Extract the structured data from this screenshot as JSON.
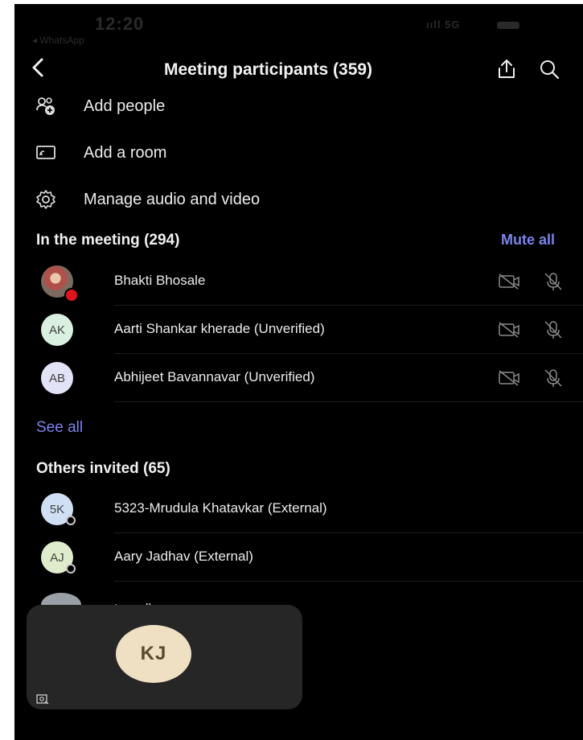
{
  "status": {
    "time": "12:20",
    "back_app": "◂ WhatsApp",
    "signal": "5G",
    "signal_bars": "ııll"
  },
  "header": {
    "title": "Meeting participants (359)"
  },
  "actions": [
    {
      "label": "Add people",
      "icon": "add-people-icon"
    },
    {
      "label": "Add a room",
      "icon": "room-icon"
    },
    {
      "label": "Manage audio and video",
      "icon": "gear-icon"
    }
  ],
  "in_meeting": {
    "heading": "In the meeting (294)",
    "mute_all": "Mute all",
    "participants": [
      {
        "name": "Bhakti Bhosale",
        "initials": "",
        "avatar": "photo",
        "avatar_color": "#b0504a"
      },
      {
        "name": "Aarti Shankar kherade (Unverified)",
        "initials": "AK",
        "avatar_color": "#d9efe0"
      },
      {
        "name": "Abhijeet Bavannavar  (Unverified)",
        "initials": "AB",
        "avatar_color": "#e2e3f7"
      }
    ],
    "see_all": "See all"
  },
  "others_invited": {
    "heading": "Others invited (65)",
    "people": [
      {
        "name": "5323-Mrudula Khatavkar (External)",
        "initials": "5K",
        "avatar_color": "#cfe0f5"
      },
      {
        "name": "Aary Jadhav (External)",
        "initials": "AJ",
        "avatar_color": "#dfeccc"
      }
    ],
    "partial_text": "ternal)"
  },
  "floating_video": {
    "initials": "KJ",
    "avatar_color": "#efe0c4"
  },
  "colors": {
    "accent": "#7b83eb",
    "background": "#000000",
    "recording": "#e0141e"
  }
}
